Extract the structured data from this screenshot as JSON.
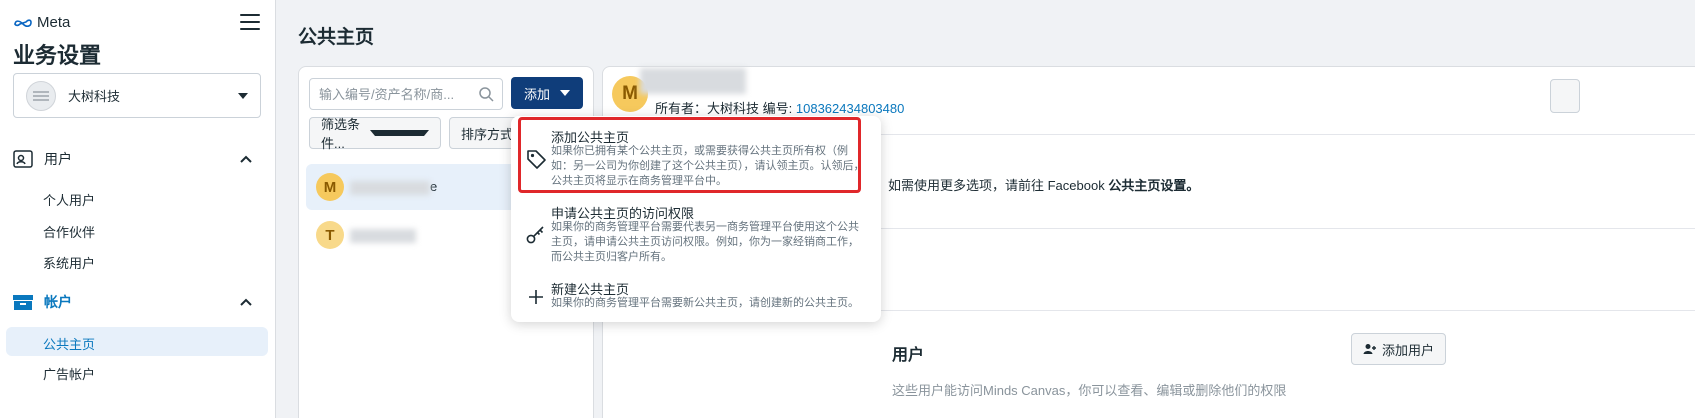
{
  "sidebar": {
    "logo": "Meta",
    "title": "业务设置",
    "account": "大树科技",
    "sections": {
      "users": {
        "label": "用户",
        "items": [
          "个人用户",
          "合作伙伴",
          "系统用户"
        ]
      },
      "accounts": {
        "label": "帐户",
        "items": [
          "公共主页",
          "广告帐户"
        ]
      }
    }
  },
  "main": {
    "title": "公共主页",
    "search_placeholder": "输入编号/资产名称/商...",
    "add_button": "添加",
    "filter_button": "筛选条件...",
    "sort_button": "排序方式",
    "list": [
      {
        "initial": "M",
        "name_suffix": "e"
      },
      {
        "initial": "T",
        "name_suffix": ""
      }
    ]
  },
  "detail": {
    "initial": "M",
    "owner_label": "所有者：大树科技",
    "id_label": "编号:",
    "id_value": "108362434803480",
    "info_prefix": "，如需使用更多选项，请前往 Facebook ",
    "info_bold": "公共主页设置。",
    "users_heading": "用户",
    "add_user_button": "添加用户",
    "cut_text": "这些用户能访问Minds Canvas，你可以查看、编辑或删除他们的权限"
  },
  "dropdown": {
    "items": [
      {
        "title": "添加公共主页",
        "desc": "如果你已拥有某个公共主页，或需要获得公共主页所有权（例如：另一公司为你创建了这个公共主页），请认领主页。认领后，公共主页将显示在商务管理平台中。",
        "icon": "tag-icon"
      },
      {
        "title": "申请公共主页的访问权限",
        "desc": "如果你的商务管理平台需要代表另一商务管理平台使用这个公共主页，请申请公共主页访问权限。例如，你为一家经销商工作，而公共主页归客户所有。",
        "icon": "key-icon"
      },
      {
        "title": "新建公共主页",
        "desc": "如果你的商务管理平台需要新公共主页，请创建新的公共主页。",
        "icon": "plus-icon"
      }
    ]
  },
  "colors": {
    "accent": "#0f3d7a",
    "link": "#0a78be",
    "highlight": "#e0272a",
    "avatar": "#f6c95d"
  }
}
